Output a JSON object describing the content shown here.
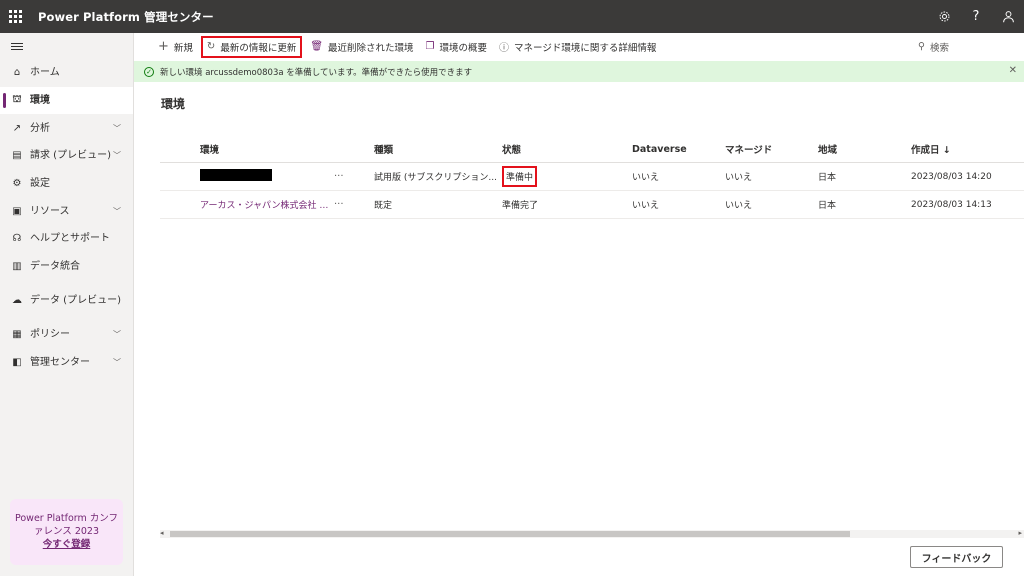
{
  "app": {
    "title": "Power Platform 管理センター"
  },
  "topbar_icons": [
    "gear-icon",
    "help-icon",
    "account-icon"
  ],
  "top_help": "?",
  "sidebar": {
    "items": [
      {
        "label": "ホーム",
        "icon": "home-icon",
        "chevron": false
      },
      {
        "label": "環境",
        "icon": "environments-icon",
        "chevron": false,
        "active": true
      },
      {
        "label": "分析",
        "icon": "analytics-icon",
        "chevron": true
      },
      {
        "label": "請求 (プレビュー)",
        "icon": "billing-icon",
        "chevron": true
      },
      {
        "label": "設定",
        "icon": "settings-icon",
        "chevron": false
      },
      {
        "label": "リソース",
        "icon": "resources-icon",
        "chevron": true
      },
      {
        "label": "ヘルプとサポート",
        "icon": "support-icon",
        "chevron": false
      },
      {
        "label": "データ統合",
        "icon": "data-integration-icon",
        "chevron": false
      },
      {
        "label": "データ (プレビュー)",
        "icon": "data-icon",
        "chevron": false
      },
      {
        "label": "ポリシー",
        "icon": "policy-icon",
        "chevron": true
      },
      {
        "label": "管理センター",
        "icon": "admin-center-icon",
        "chevron": true
      }
    ],
    "promo": {
      "line1": "Power Platform カンフ",
      "line2": "ァレンス 2023",
      "link": "今すぐ登録"
    }
  },
  "commandbar": {
    "new": "新規",
    "refresh": "最新の情報に更新",
    "recently_deleted": "最近削除された環境",
    "overview": "環境の概要",
    "managed_details": "マネージド環境に関する詳細情報",
    "search_placeholder": "検索"
  },
  "notice": {
    "text": "新しい環境 arcussdemo0803a を準備しています。準備ができたら使用できます"
  },
  "page": {
    "title": "環境"
  },
  "table": {
    "columns": {
      "name": "環境",
      "type": "種類",
      "status": "状態",
      "dataverse": "Dataverse",
      "managed": "マネージド",
      "region": "地域",
      "created": "作成日 ↓"
    },
    "rows": [
      {
        "name": "",
        "redacted": true,
        "more": "···",
        "type": "試用版 (サブスクリプション...",
        "status": "準備中",
        "dataverse": "いいえ",
        "managed": "いいえ",
        "region": "日本",
        "created": "2023/08/03 14:20"
      },
      {
        "name": "アーカス・ジャパン株式会社 (...",
        "redacted": false,
        "more": "···",
        "type": "既定",
        "status": "準備完了",
        "dataverse": "いいえ",
        "managed": "いいえ",
        "region": "日本",
        "created": "2023/08/03 14:13"
      }
    ]
  },
  "feedback": {
    "label": "フィードバック"
  }
}
